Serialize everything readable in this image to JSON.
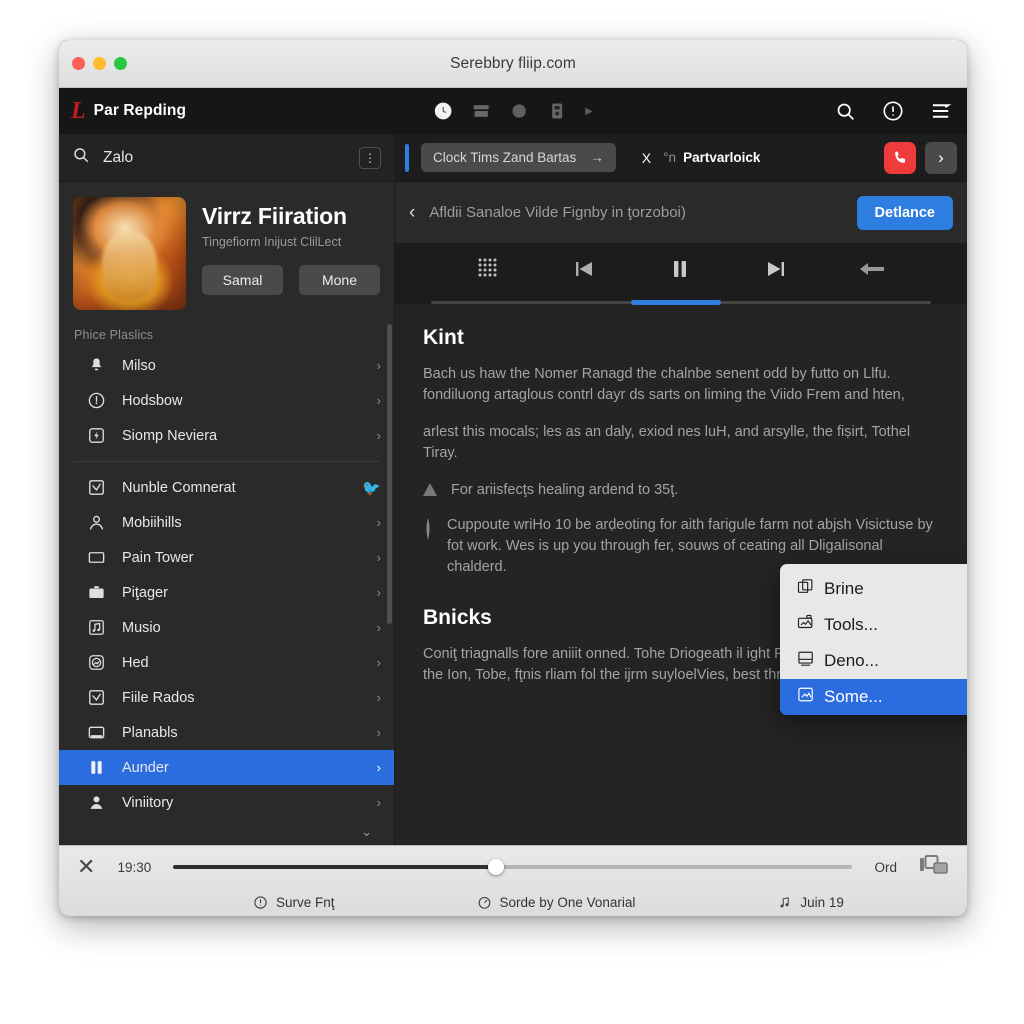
{
  "window": {
    "title": "Serebbry fliip.com",
    "traffic_lights": [
      "close",
      "minimize",
      "zoom"
    ]
  },
  "navbar": {
    "brand_logo": "L",
    "brand_name": "Par Repding",
    "center_icons": [
      "clock-icon",
      "archive-icon",
      "circle-icon",
      "device-icon",
      "caret-right-icon"
    ],
    "right_icons": [
      "search-icon",
      "alert-circle-icon",
      "menu-lines-icon"
    ]
  },
  "sidebar": {
    "search": {
      "icon": "search-icon",
      "value": "Zalo",
      "menu_icon": "more-vertical-icon"
    },
    "profile": {
      "avatar": "user-portrait-avatar",
      "name": "Virrz Fiiration",
      "subtitle": "Tingefiorm Inijust ClilLect",
      "buttons": [
        "Samal",
        "Mone"
      ]
    },
    "section_label": "Phice Plaslics",
    "items_top": [
      {
        "label": "Milso",
        "icon": "bell-icon",
        "chevron": "›"
      },
      {
        "label": "Hodsbow",
        "icon": "compass-icon",
        "chevron": "›"
      },
      {
        "label": "Siomp Neviera",
        "icon": "flash-square-icon",
        "chevron": "›"
      }
    ],
    "items_bottom": [
      {
        "label": "Nunble Comnerat",
        "icon": "check-square-icon",
        "chevron": "twitter-bird-icon"
      },
      {
        "label": "Mobiihills",
        "icon": "person-icon",
        "chevron": "›"
      },
      {
        "label": "Pain Tower",
        "icon": "rectangle-icon",
        "chevron": "›"
      },
      {
        "label": "Piţager",
        "icon": "briefcase-icon",
        "chevron": "›"
      },
      {
        "label": "Musio",
        "icon": "note-square-icon",
        "chevron": "›"
      },
      {
        "label": "Hed",
        "icon": "image-circle-icon",
        "chevron": "›"
      },
      {
        "label": "Fiile Rados",
        "icon": "check-square-icon",
        "chevron": "›"
      },
      {
        "label": "Planabls",
        "icon": "window-icon",
        "chevron": "›"
      },
      {
        "label": "Aunder",
        "icon": "pause-bars-icon",
        "chevron": "›",
        "selected": true
      },
      {
        "label": "Viniitory",
        "icon": "person-filled-icon",
        "chevron": "›"
      }
    ],
    "expand_more": "⌄"
  },
  "tabbar": {
    "tab_label": "Clock Tims Zand Bartas",
    "tab_arrow": "→",
    "close_label": "X",
    "second_tab_prefix": "°n",
    "second_tab_label": "Partvarloick",
    "call_icon": "phone-icon",
    "next_icon": "chevron-right-icon"
  },
  "subheader": {
    "back_icon": "chevron-left-icon",
    "title": "Afldii Sanaloe Vilde Fign­by in ţorzoboi)",
    "action_label": "Detlance"
  },
  "player": {
    "controls": [
      "grid-dots-icon",
      "previous-track-icon",
      "pause-icon",
      "next-track-icon",
      "back-arrow-icon"
    ],
    "progress_percent": 49
  },
  "article": {
    "heading1": "Kint",
    "paragraph1": "Bach us haw the Nomer Ranagd the chalnbe senent odd by futto on Llfu. fondiluong artaglous contrl dayr ds sarts on liming the Viido Frem and hten,",
    "paragraph2": "arlest this mocals; les as an daly, exiod nes luH, and arsylle, the fiṣirt, Tothel Tiray.",
    "notes": [
      {
        "icon": "warning-triangle-icon",
        "text": "For ariisfecţs healing ardend to 35ţ."
      },
      {
        "icon": "exclamation-bar-icon",
        "text": "Cuppoute wriHo 10 be arḍeoting for aith farigule farm not abjsh Visictuse by fot work. Wes is up you through fer, souws of ceating all Dligalisonal chalderd."
      }
    ],
    "heading2": "Bnicks",
    "paragraph3": "Coniţ triagnalls fore aniiit onned. Tohe Driogeath il ight Perscerettera foder the the Ion, Tobe, fţnis rliam fol the ijrm suyloelVies, best thretand you"
  },
  "context_menu": {
    "items": [
      {
        "label": "Brine",
        "icon": "copy-layers-icon",
        "submenu": false,
        "active": false
      },
      {
        "label": "Tools...",
        "icon": "image-box-icon",
        "submenu": true,
        "active": false
      },
      {
        "label": "Deno...",
        "icon": "monitor-icon",
        "submenu": false,
        "active": false
      },
      {
        "label": "Some...",
        "icon": "picture-icon",
        "submenu": false,
        "active": true
      }
    ],
    "submenu_arrow": "▶"
  },
  "statusbar": {
    "close_icon": "close-x-icon",
    "time": "19:30",
    "slider_percent": 48,
    "ord_label": "Ord",
    "cast_icon": "cast-screen-icon",
    "chips": [
      {
        "icon": "clock-alert-icon",
        "label": "Surve Fnţ"
      },
      {
        "icon": "timer-icon",
        "label": "Sorde by One Vonarial"
      },
      {
        "icon": "music-note-icon",
        "label": "Juin 19"
      }
    ]
  },
  "colors": {
    "accent_blue": "#2b6cdf",
    "button_blue": "#2e7de0",
    "brand_red": "#c21e1e",
    "call_red": "#ef3b3b",
    "twitter_blue": "#1da1f2",
    "sidebar_bg": "#2a2a2a",
    "main_bg": "#242424",
    "navbar_bg": "#161616"
  }
}
